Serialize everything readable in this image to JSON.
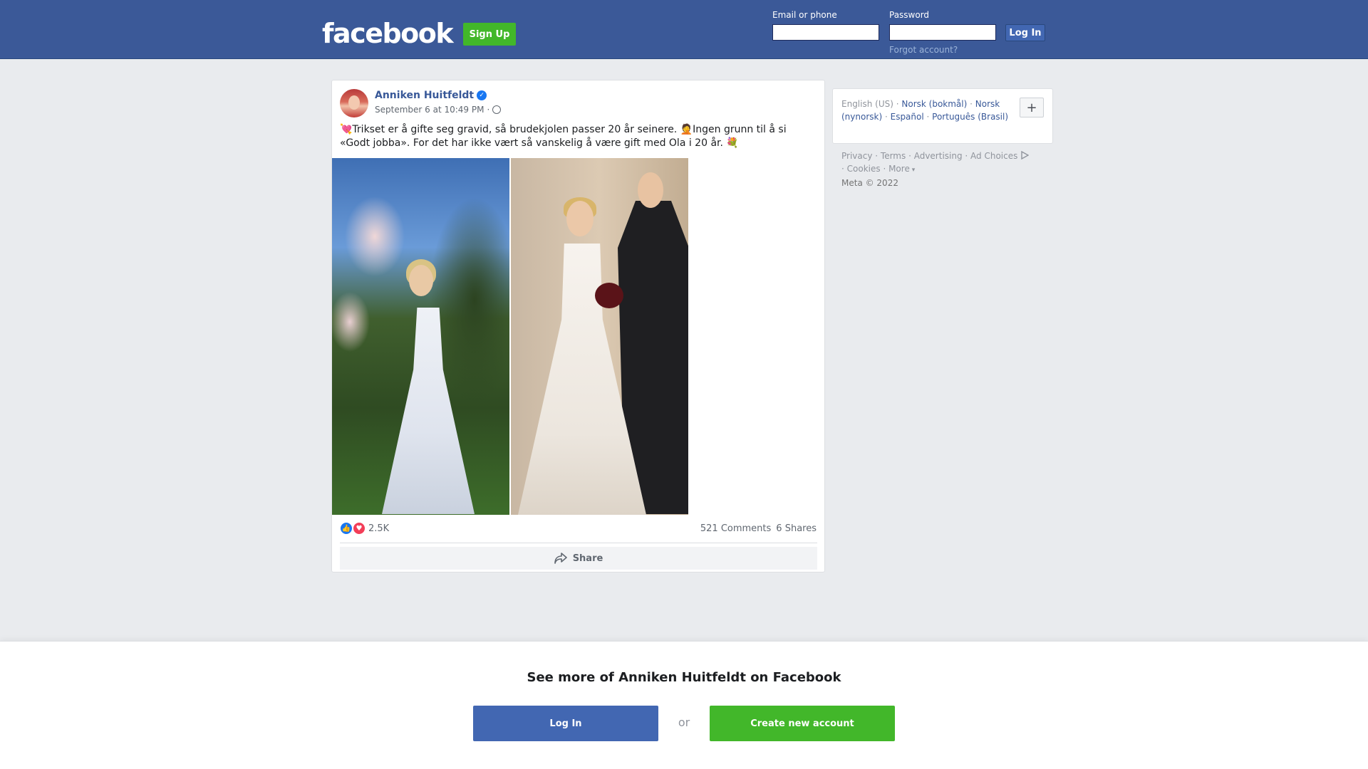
{
  "header": {
    "logo": "facebook",
    "signup_label": "Sign Up",
    "email_label": "Email or phone",
    "email_value": "",
    "password_label": "Password",
    "password_value": "",
    "login_label": "Log In",
    "forgot_label": "Forgot account?"
  },
  "post": {
    "author": "Anniken Huitfeldt",
    "timestamp": "September 6 at 10:49 PM",
    "separator": "·",
    "text": "💘Trikset er å gifte seg gravid, så brudekjolen passer 20 år seinere. 🤦Ingen grunn til å si «Godt jobba». For det har ikke vært så vanskelig å være gift med Ola i 20 år. 💐",
    "reaction_count": "2.5K",
    "comments": "521 Comments",
    "shares": "6 Shares",
    "share_label": "Share"
  },
  "sidebar": {
    "languages": [
      {
        "label": "English (US)"
      },
      {
        "label": "Norsk (bokmål)"
      },
      {
        "label": "Norsk (nynorsk)"
      },
      {
        "label": "Español"
      },
      {
        "label": "Português (Brasil)"
      }
    ],
    "add_language": "+",
    "footer_links": [
      "Privacy",
      "Terms",
      "Advertising",
      "Ad Choices",
      "Cookies",
      "More"
    ],
    "copyright": "Meta © 2022"
  },
  "bottom": {
    "title": "See more of Anniken Huitfeldt on Facebook",
    "login_label": "Log In",
    "or_label": "or",
    "create_label": "Create new account"
  },
  "colors": {
    "brand": "#3b5998",
    "button_blue": "#4267b2",
    "green": "#42b72a",
    "link": "#385898"
  }
}
